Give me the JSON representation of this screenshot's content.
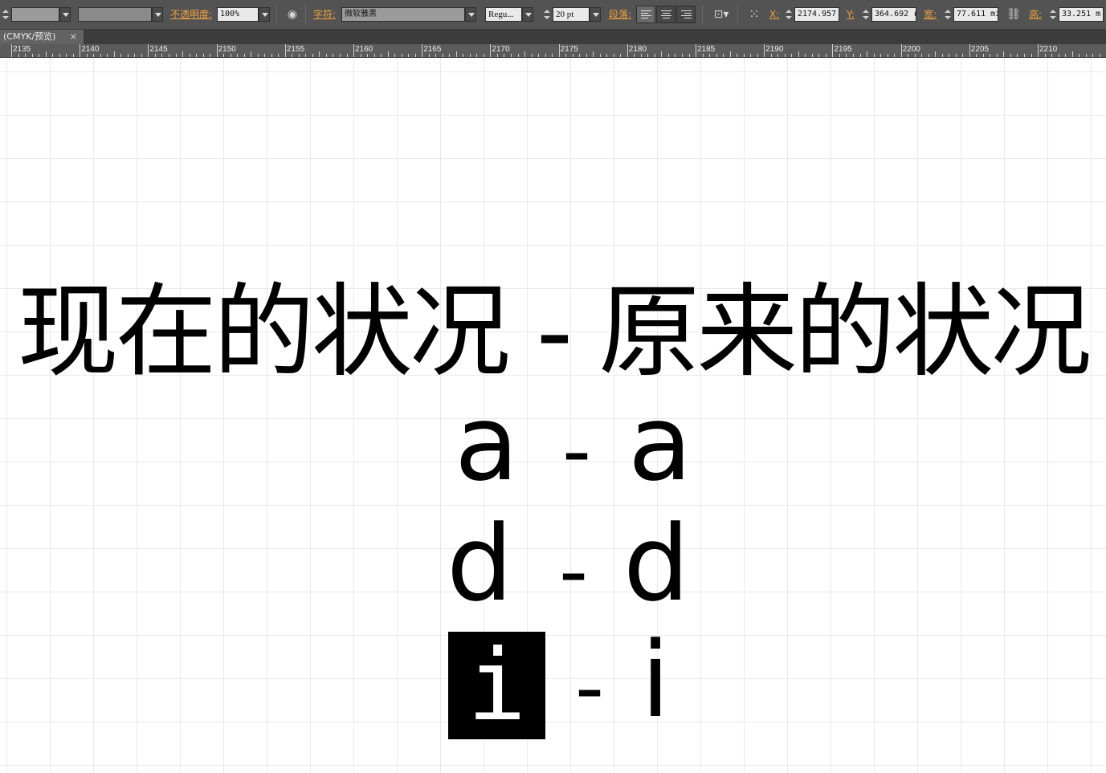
{
  "control_bar": {
    "opacity_label": "不透明度:",
    "opacity_value": "100%",
    "character_label": "字符:",
    "font_family": "微软雅黑",
    "font_style": "Regu...",
    "font_size": "20 pt",
    "paragraph_label": "段落:",
    "x_label": "X:",
    "x_value": "2174.957",
    "y_label": "Y:",
    "y_value": "364.692 r",
    "width_label": "宽:",
    "width_value": "77.611 mı",
    "height_label": "高:",
    "height_value": "33.251 m"
  },
  "tab": {
    "title": "(CMYK/预览)",
    "close": "×"
  },
  "ruler": {
    "labels": [
      "2135",
      "2140",
      "2145",
      "2150",
      "2155",
      "2160",
      "2165",
      "2170",
      "2175",
      "2180",
      "2185",
      "2190",
      "2195",
      "2200",
      "2205",
      "2210"
    ]
  },
  "artboard": {
    "headline": "现在的状况 - 原来的状况",
    "rows": [
      {
        "left": "a",
        "dash": "-",
        "right": "a"
      },
      {
        "left": "d",
        "dash": "-",
        "right": "d"
      },
      {
        "left": "i",
        "dash": "-",
        "right": "i"
      }
    ]
  },
  "colors": {
    "panel_bg": "#535353",
    "label_orange": "#f0a23c",
    "canvas_bg": "#ffffff",
    "selection_bg": "#000000"
  }
}
